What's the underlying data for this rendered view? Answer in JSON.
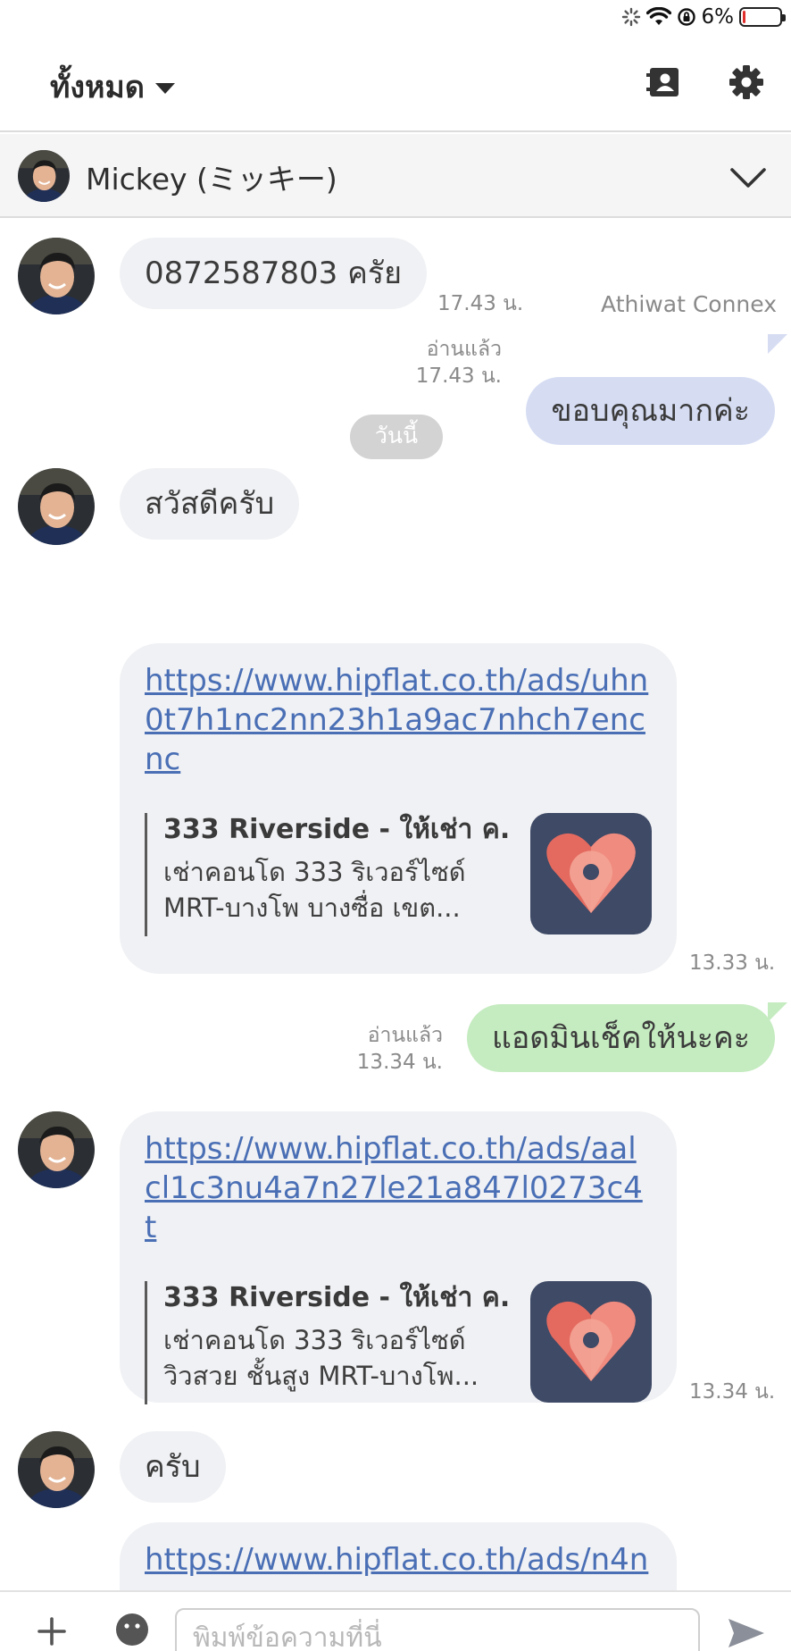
{
  "status_bar": {
    "battery_text": "6%",
    "battery_level": 0.06
  },
  "header": {
    "title": "ทั้งหมด"
  },
  "contact": {
    "name": "Mickey (ミッキー)"
  },
  "messages": {
    "m1": {
      "text": "0872587803 ครัย",
      "time": "17.43 น."
    },
    "m2": {
      "sender": "Athiwat Connex",
      "text": "ขอบคุณมากค่ะ",
      "read": "อ่านแล้ว",
      "time": "17.43 น."
    },
    "date_label": "วันนี้",
    "m3": {
      "text": "สวัสดีครับ"
    },
    "m4": {
      "url": "https://www.hipflat.co.th/ads/uhn0t7h1nc2nn23h1a9ac7nhch7encnc",
      "preview_title": "333 Riverside - ให้เช่า ค...",
      "preview_desc": "เช่าคอนโด 333 ริเวอร์ไซด์\nMRT-บางโพ บางซื่อ เขต...",
      "time": "13.33 น."
    },
    "m5": {
      "text": "แอดมินเช็คให้นะคะ",
      "read": "อ่านแล้ว",
      "time": "13.34 น."
    },
    "m6": {
      "url": "https://www.hipflat.co.th/ads/aalcl1c3nu4a7n27le21a847l0273c4t",
      "preview_title": "333 Riverside - ให้เช่า ค...",
      "preview_desc": "เช่าคอนโด 333 ริเวอร์ไซด์\nวิวสวย ชั้นสูง MRT-บางโพ...",
      "time": "13.34 น."
    },
    "m7": {
      "text": "ครับ"
    },
    "m8": {
      "url": "https://www.hipflat.co.th/ads/n4n"
    }
  },
  "input": {
    "placeholder": "พิมพ์ข้อความที่นี่"
  },
  "colors": {
    "incoming_bubble": "#f0f1f4",
    "outgoing_blue": "#d6ddf3",
    "outgoing_green": "#c5ebc0",
    "link": "#4a6fb5",
    "thumb_bg": "#3e4a66",
    "heart": "#e46a5f"
  },
  "icons": [
    "loading-icon",
    "wifi-icon",
    "rotation-lock-icon",
    "battery-icon",
    "contacts-book-icon",
    "gear-icon",
    "chevron-down-icon",
    "plus-icon",
    "emoji-icon",
    "send-icon"
  ]
}
